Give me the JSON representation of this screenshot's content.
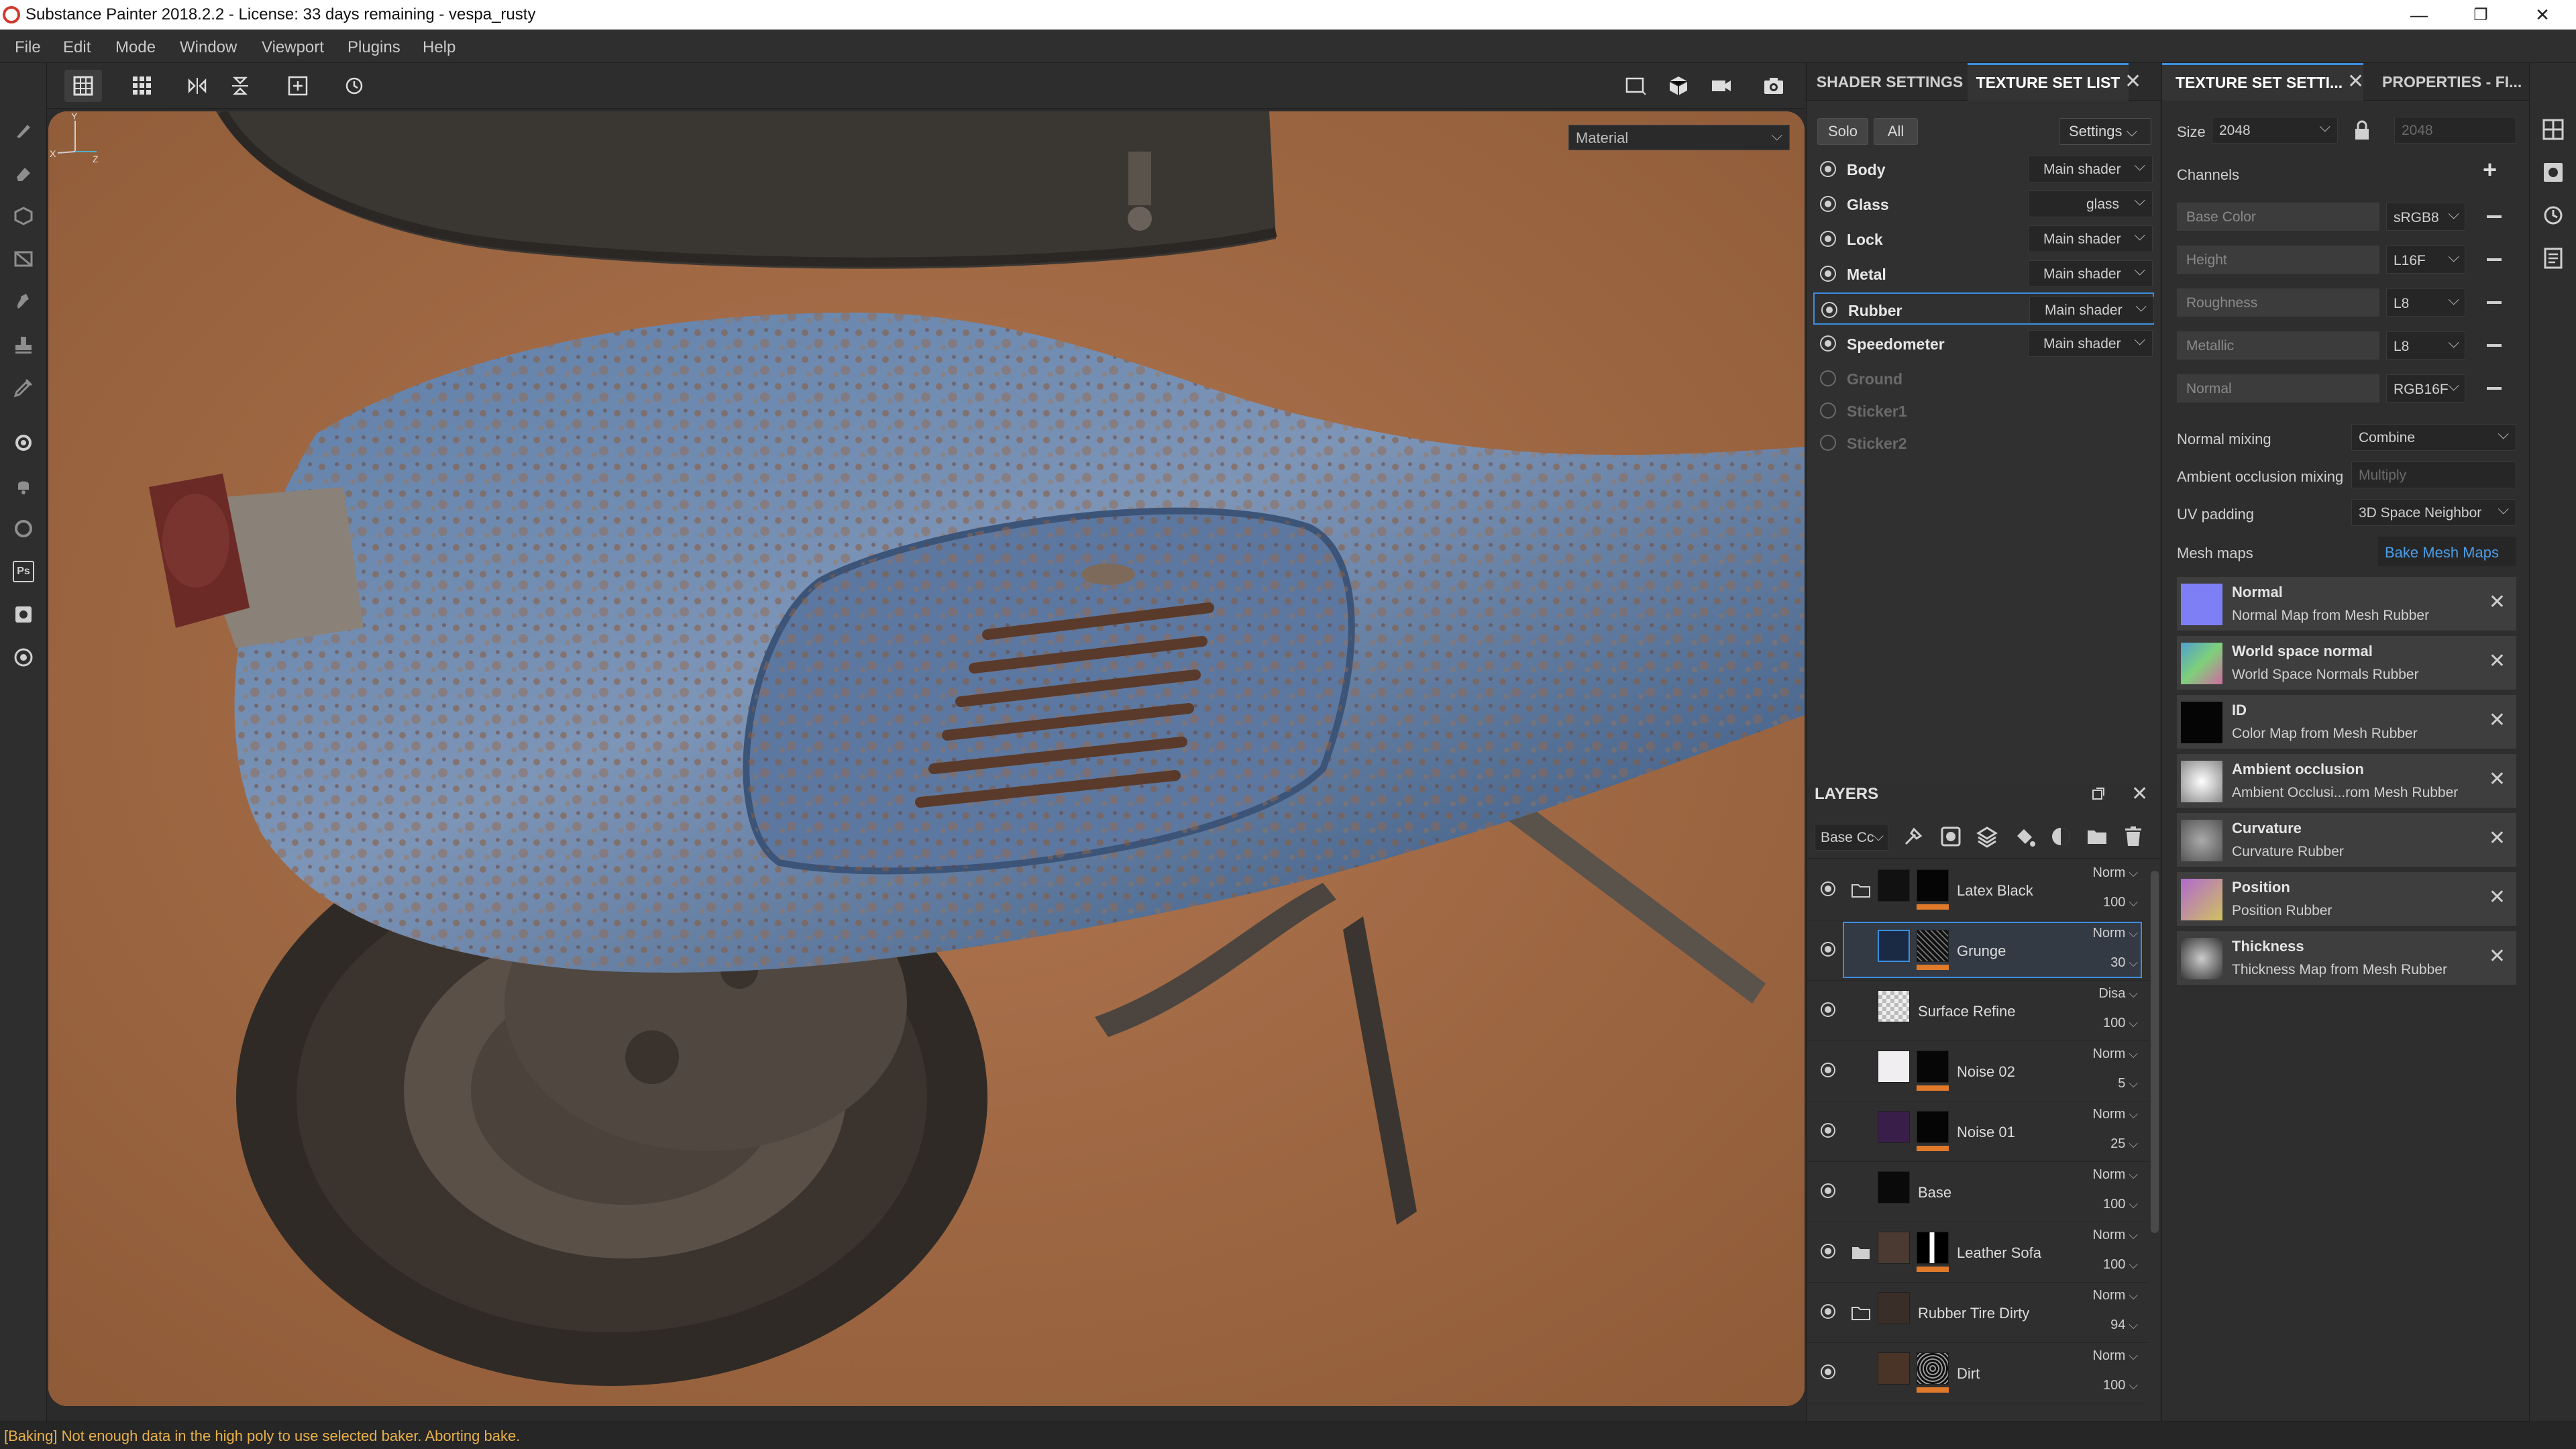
{
  "window": {
    "title": "Substance Painter 2018.2.2 - License: 33 days remaining - vespa_rusty",
    "controls": [
      "minimize",
      "maximize",
      "close"
    ]
  },
  "menu": [
    "File",
    "Edit",
    "Mode",
    "Window",
    "Viewport",
    "Plugins",
    "Help"
  ],
  "viewport": {
    "material_mode": "Material",
    "axis": {
      "y": "Y",
      "x": "X",
      "z": "Z"
    }
  },
  "texture_set_panel": {
    "tabs": [
      "SHADER SETTINGS",
      "TEXTURE SET LIST"
    ],
    "active_tab": "TEXTURE SET LIST",
    "solo_label": "Solo",
    "all_label": "All",
    "settings_label": "Settings",
    "sets": [
      {
        "name": "Body",
        "shader": "Main shader",
        "enabled": true
      },
      {
        "name": "Glass",
        "shader": "glass",
        "enabled": true
      },
      {
        "name": "Lock",
        "shader": "Main shader",
        "enabled": true
      },
      {
        "name": "Metal",
        "shader": "Main shader",
        "enabled": true
      },
      {
        "name": "Rubber",
        "shader": "Main shader",
        "enabled": true,
        "selected": true
      },
      {
        "name": "Speedometer",
        "shader": "Main shader",
        "enabled": true
      },
      {
        "name": "Ground",
        "enabled": false
      },
      {
        "name": "Sticker1",
        "enabled": false
      },
      {
        "name": "Sticker2",
        "enabled": false
      }
    ]
  },
  "layers_panel": {
    "title": "LAYERS",
    "channel": "Base Cc",
    "layers": [
      {
        "name": "Latex Black",
        "blend": "Norm",
        "opacity": "100",
        "folder": true
      },
      {
        "name": "Grunge",
        "blend": "Norm",
        "opacity": "30",
        "selected": true
      },
      {
        "name": "Surface Refine",
        "blend": "Disa",
        "opacity": "100"
      },
      {
        "name": "Noise 02",
        "blend": "Norm",
        "opacity": "5"
      },
      {
        "name": "Noise 01",
        "blend": "Norm",
        "opacity": "25"
      },
      {
        "name": "Base",
        "blend": "Norm",
        "opacity": "100"
      },
      {
        "name": "Leather Sofa",
        "blend": "Norm",
        "opacity": "100",
        "folder": true
      },
      {
        "name": "Rubber Tire Dirty",
        "blend": "Norm",
        "opacity": "94",
        "folder": true
      },
      {
        "name": "Dirt",
        "blend": "Norm",
        "opacity": "100"
      }
    ]
  },
  "properties_panel": {
    "tabs": [
      "TEXTURE SET SETTI...",
      "PROPERTIES - FI..."
    ],
    "active_tab": "TEXTURE SET SETTI...",
    "size_label": "Size",
    "size_value": "2048",
    "size_linked_value": "2048",
    "channels_label": "Channels",
    "channels": [
      {
        "name": "Base Color",
        "format": "sRGB8"
      },
      {
        "name": "Height",
        "format": "L16F"
      },
      {
        "name": "Roughness",
        "format": "L8"
      },
      {
        "name": "Metallic",
        "format": "L8"
      },
      {
        "name": "Normal",
        "format": "RGB16F"
      }
    ],
    "normal_mixing_label": "Normal mixing",
    "normal_mixing_value": "Combine",
    "ao_mixing_label": "Ambient occlusion mixing",
    "ao_mixing_value": "Multiply",
    "uv_padding_label": "UV padding",
    "uv_padding_value": "3D Space Neighbor",
    "mesh_maps_label": "Mesh maps",
    "bake_button": "Bake Mesh Maps",
    "mesh_maps": [
      {
        "title": "Normal",
        "subtitle": "Normal Map from Mesh Rubber",
        "color": "#7f7ff5"
      },
      {
        "title": "World space normal",
        "subtitle": "World Space Normals Rubber",
        "color": "#6fa07a"
      },
      {
        "title": "ID",
        "subtitle": "Color Map from Mesh Rubber",
        "color": "#050505"
      },
      {
        "title": "Ambient occlusion",
        "subtitle": "Ambient Occlusi...rom Mesh Rubber",
        "color": "#cfcfcf"
      },
      {
        "title": "Curvature",
        "subtitle": "Curvature Rubber",
        "color": "#8a8a8a"
      },
      {
        "title": "Position",
        "subtitle": "Position Rubber",
        "color": "#9a6fb0"
      },
      {
        "title": "Thickness",
        "subtitle": "Thickness Map from Mesh Rubber",
        "color": "#6a6a6a"
      }
    ]
  },
  "status": {
    "message": "[Baking] Not enough data in the high poly to use selected baker. Aborting bake."
  },
  "colors": {
    "accent": "#3b8ee0",
    "status_warning": "#e8b04a",
    "layer_mask_bar": "#e07a2a",
    "viewport_bg": "#a46a43"
  }
}
